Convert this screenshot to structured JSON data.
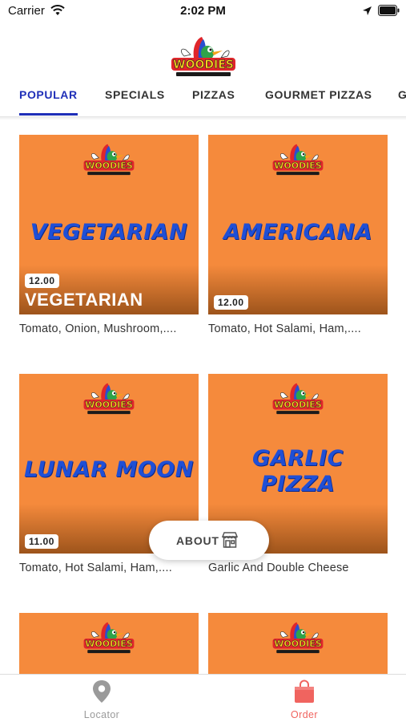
{
  "status_bar": {
    "carrier": "Carrier",
    "time": "2:02 PM",
    "icons": [
      "wifi-icon",
      "location-arrow-icon",
      "battery-icon"
    ]
  },
  "header": {
    "logo": "woodies-logo"
  },
  "tabs": [
    {
      "label": "POPULAR",
      "active": true
    },
    {
      "label": "SPECIALS",
      "active": false
    },
    {
      "label": "PIZZAS",
      "active": false
    },
    {
      "label": "GOURMET PIZZAS",
      "active": false
    },
    {
      "label": "G",
      "active": false
    }
  ],
  "products": [
    {
      "art_text": "VEGETARIAN",
      "price": "12.00",
      "overlay_name": "VEGETARIAN",
      "description": "Tomato, Onion, Mushroom,...."
    },
    {
      "art_text": "AMERICANA",
      "price": "12.00",
      "overlay_name": "",
      "description": "Tomato, Hot Salami, Ham,...."
    },
    {
      "art_text": "LUNAR MOON",
      "price": "11.00",
      "overlay_name": "",
      "description": "Tomato, Hot Salami, Ham,...."
    },
    {
      "art_text_line1": "GARLIC",
      "art_text_line2": "PIZZA",
      "description": "Garlic And Double Cheese"
    }
  ],
  "about_button": {
    "label": "ABOUT",
    "icon": "store-icon"
  },
  "bottom_nav": [
    {
      "label": "Locator",
      "icon": "map-pin-icon",
      "color": "#9a9a9a"
    },
    {
      "label": "Order",
      "icon": "shopping-bag-icon",
      "color": "#f0645f"
    }
  ],
  "colors": {
    "accent": "#1f2fb8",
    "card_bg": "#f58a3c",
    "art_text": "#1f4fd6",
    "order_red": "#f0645f"
  }
}
